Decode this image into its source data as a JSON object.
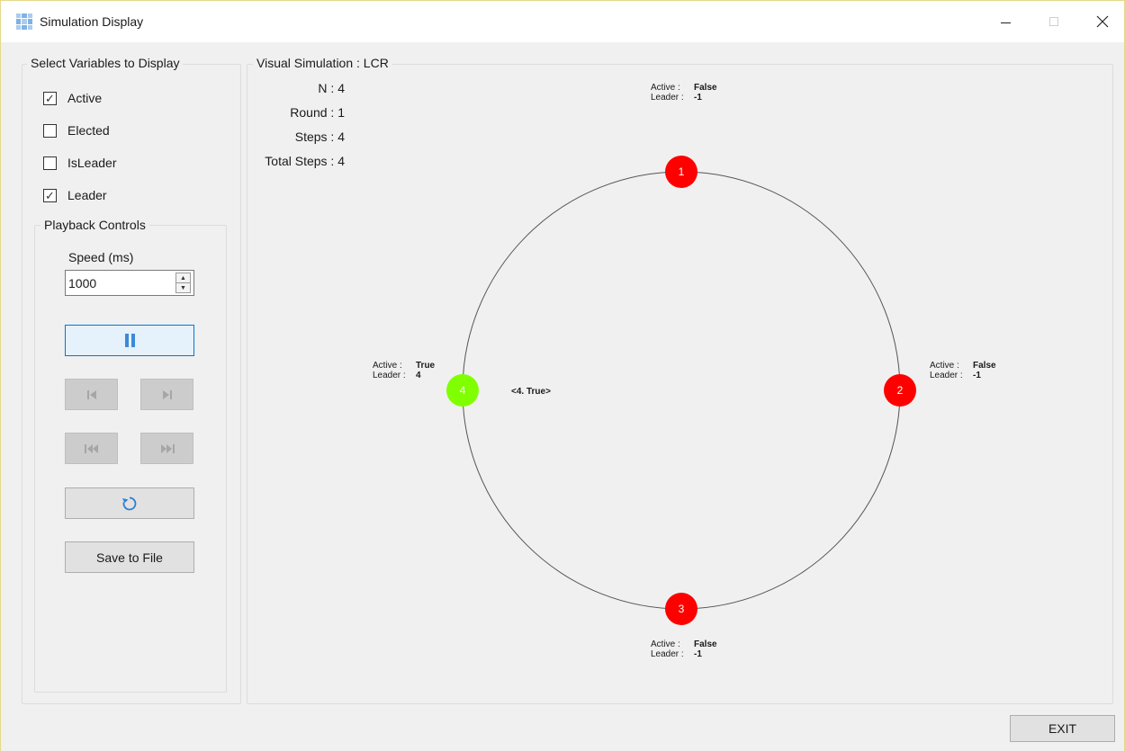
{
  "window": {
    "title": "Simulation Display"
  },
  "variables": {
    "title": "Select Variables to Display",
    "items": [
      {
        "label": "Active",
        "checked": true
      },
      {
        "label": "Elected",
        "checked": false
      },
      {
        "label": "IsLeader",
        "checked": false
      },
      {
        "label": "Leader",
        "checked": true
      }
    ]
  },
  "playback": {
    "title": "Playback Controls",
    "speed_label": "Speed (ms)",
    "speed_value": "1000",
    "save_label": "Save to File"
  },
  "simulation": {
    "title": "Visual Simulation : LCR",
    "stats": [
      "N : 4",
      "Round : 1",
      "Steps : 4",
      "Total Steps : 4"
    ],
    "message": "<4. True>",
    "nodes": [
      {
        "id": "1",
        "active": "False",
        "leader": "-1",
        "color": "#ff0000"
      },
      {
        "id": "2",
        "active": "False",
        "leader": "-1",
        "color": "#ff0000"
      },
      {
        "id": "3",
        "active": "False",
        "leader": "-1",
        "color": "#ff0000"
      },
      {
        "id": "4",
        "active": "True",
        "leader": "4",
        "color": "#7fff00"
      }
    ],
    "active_label": "Active :",
    "leader_label": "Leader :"
  },
  "footer": {
    "exit_label": "EXIT"
  }
}
